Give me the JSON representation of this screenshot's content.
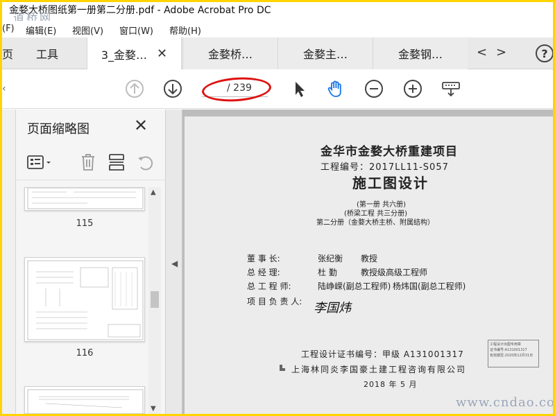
{
  "window": {
    "title": "金婺大桥图纸第一册第二分册.pdf - Adobe Acrobat Pro DC",
    "watermark_top": "道桥网"
  },
  "menu": {
    "items": [
      "(F)",
      "编辑(E)",
      "视图(V)",
      "窗口(W)",
      "帮助(H)"
    ]
  },
  "tabs": {
    "home_partial": "页",
    "tools": "工具",
    "docs": [
      {
        "label": "3_金婺…",
        "active": true
      },
      {
        "label": "金婺桥…",
        "active": false
      },
      {
        "label": "金婺主…",
        "active": false
      },
      {
        "label": "金婺钢…",
        "active": false
      }
    ],
    "help": "?"
  },
  "toolbar": {
    "page_current": "",
    "page_total": "/ 239"
  },
  "thumbnails": {
    "title": "页面缩略图",
    "pages": [
      "115",
      "116"
    ]
  },
  "document": {
    "title": "金华市金婺大桥重建项目",
    "project_code": "工程编号：2017LL11-S057",
    "design": "施工图设计",
    "vol_line1": "(第一册  共六册)",
    "vol_line2": "(桥梁工程  共三分册)",
    "vol_line3": "第二分册（金婺大桥主桥、附属结构）",
    "rows": [
      {
        "role": "董    事    长:",
        "name": "张纪衡",
        "title": "教授"
      },
      {
        "role": "总    经    理:",
        "name": "杜  勤",
        "title": "教授级高级工程师"
      },
      {
        "role": "总  工  程  师:",
        "name": "陆峥嵘(副总工程师)",
        "title": "杨炜国(副总工程师)"
      },
      {
        "role": "项 目 负 责 人:",
        "name": "",
        "title": ""
      }
    ],
    "signature": "李国炜",
    "cert": "工程设计证书编号：甲级 A131001317",
    "company": "上海林同炎李国豪土建工程咨询有限公司",
    "date": "2018 年 5 月",
    "stamp_lines": [
      "工程设计出图专用章",
      "证书编号:A131001317",
      "有效期至:2020年12月31日"
    ]
  },
  "watermark_bottom": "www.cndao.com"
}
